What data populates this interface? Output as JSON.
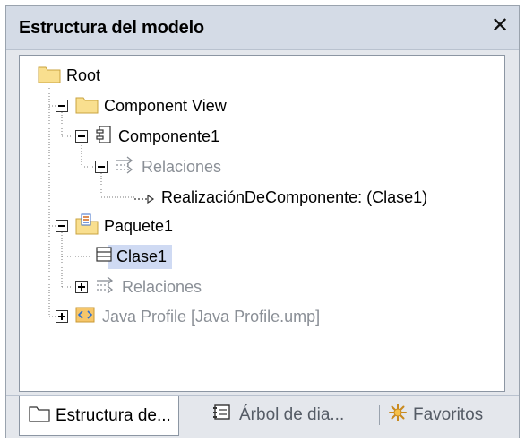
{
  "panel": {
    "title": "Estructura del modelo",
    "close_glyph": "✕"
  },
  "tree": {
    "nodes": {
      "root": {
        "label": "Root",
        "icon": "folder-icon"
      },
      "component_view": {
        "label": "Component View",
        "icon": "folder-icon"
      },
      "componente1": {
        "label": "Componente1",
        "icon": "component-icon"
      },
      "relaciones1": {
        "label": "Relaciones",
        "icon": "relations-icon"
      },
      "realizacion": {
        "label": "RealizaciónDeComponente:  (Clase1)",
        "icon": "realization-arrow-icon"
      },
      "paquete1": {
        "label": "Paquete1",
        "icon": "java-package-icon"
      },
      "clase1": {
        "label": "Clase1",
        "icon": "class-icon"
      },
      "relaciones2": {
        "label": "Relaciones",
        "icon": "relations-icon"
      },
      "java_profile": {
        "label": "Java Profile [Java Profile.ump]",
        "icon": "profile-icon"
      }
    }
  },
  "tabs": [
    {
      "label": "Estructura de...",
      "icon": "folder-outline-icon",
      "active": true
    },
    {
      "label": "Árbol de dia...",
      "icon": "diagram-tree-icon",
      "active": false
    },
    {
      "label": "Favoritos",
      "icon": "favorites-icon",
      "active": false
    }
  ],
  "colors": {
    "titlebar_bg": "#d4dbe6",
    "selection_bg": "#cfdaf3",
    "folder_fill": "#f9df8f",
    "dim_text": "#8a8f96"
  }
}
